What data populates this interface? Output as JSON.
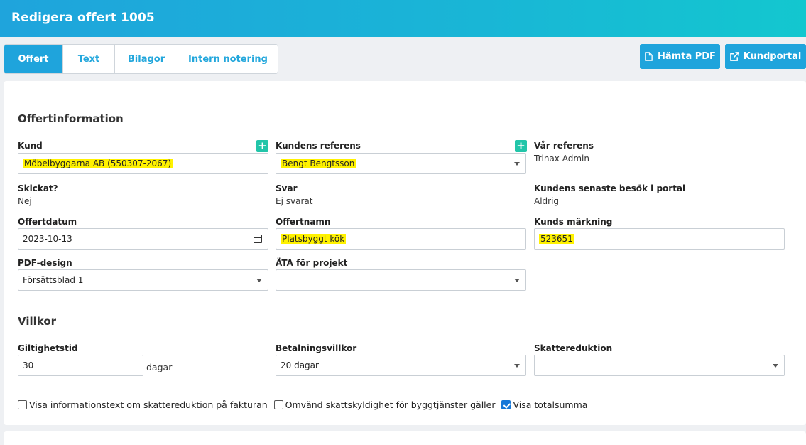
{
  "header": {
    "title": "Redigera offert 1005"
  },
  "tabs": [
    {
      "label": "Offert",
      "active": true
    },
    {
      "label": "Text",
      "active": false
    },
    {
      "label": "Bilagor",
      "active": false
    },
    {
      "label": "Intern notering",
      "active": false
    }
  ],
  "actions": {
    "pdf_label": "Hämta PDF",
    "portal_label": "Kundportal"
  },
  "offer_info": {
    "title": "Offertinformation",
    "kund": {
      "label": "Kund",
      "value": "Möbelbyggarna AB (550307-2067)"
    },
    "kundens_referens": {
      "label": "Kundens referens",
      "value": "Bengt Bengtsson"
    },
    "var_referens": {
      "label": "Vår referens",
      "value": "Trinax Admin"
    },
    "skickat": {
      "label": "Skickat?",
      "value": "Nej"
    },
    "svar": {
      "label": "Svar",
      "value": "Ej svarat"
    },
    "senaste_besok": {
      "label": "Kundens senaste besök i portal",
      "value": "Aldrig"
    },
    "offertdatum": {
      "label": "Offertdatum",
      "value": "2023-10-13"
    },
    "offertnamn": {
      "label": "Offertnamn",
      "value": "Platsbyggt kök"
    },
    "kunds_markning": {
      "label": "Kunds märkning",
      "value": "523651"
    },
    "pdf_design": {
      "label": "PDF-design",
      "value": "Försättsblad 1"
    },
    "ata_projekt": {
      "label": "ÄTA för projekt",
      "value": ""
    }
  },
  "terms": {
    "title": "Villkor",
    "giltighetstid": {
      "label": "Giltighetstid",
      "value": "30",
      "unit": "dagar"
    },
    "betalningsvillkor": {
      "label": "Betalningsvillkor",
      "value": "20 dagar"
    },
    "skattereduktion": {
      "label": "Skattereduktion",
      "value": ""
    }
  },
  "checkboxes": [
    {
      "label": "Visa informationstext om skattereduktion på fakturan",
      "checked": false
    },
    {
      "label": "Omvänd skattskyldighet för byggtjänster gäller",
      "checked": false
    },
    {
      "label": "Visa totalsumma",
      "checked": true
    }
  ],
  "colors": {
    "accent": "#1fa4dc",
    "add": "#22c5a9",
    "highlight": "#fff200"
  }
}
